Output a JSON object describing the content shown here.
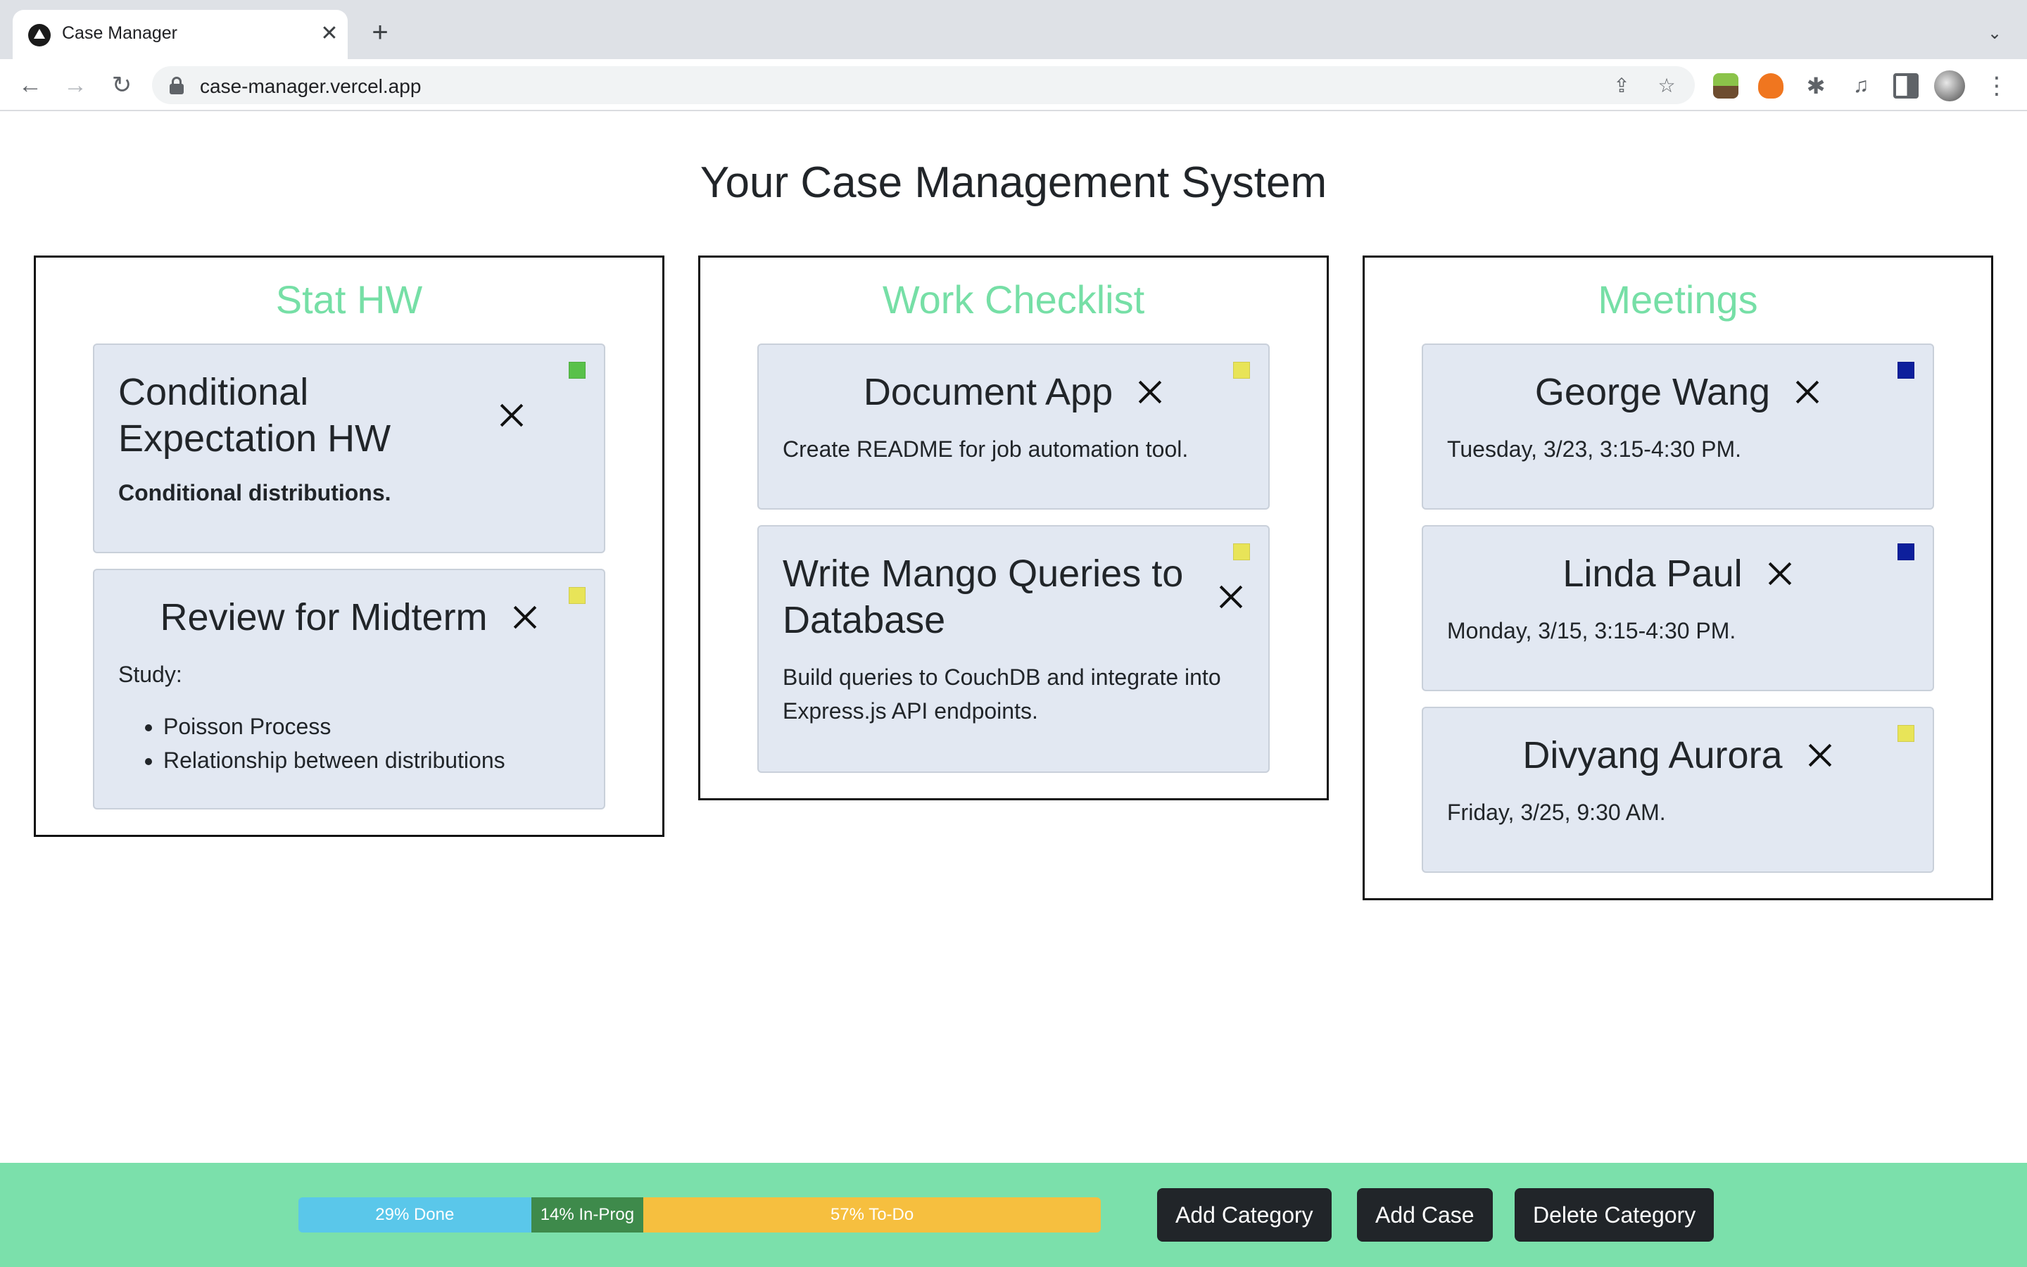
{
  "browser": {
    "tab_title": "Case Manager",
    "url": "case-manager.vercel.app"
  },
  "page": {
    "title": "Your Case Management System"
  },
  "categories": [
    {
      "title": "Stat HW",
      "cases": [
        {
          "title": "Conditional Expectation HW",
          "description": "Conditional distributions.",
          "status_color": "#59c14a"
        },
        {
          "title": "Review for Midterm",
          "description": "Study:",
          "items": [
            "Poisson Process",
            "Relationship between distributions"
          ],
          "status_color": "#e8e458"
        }
      ]
    },
    {
      "title": "Work Checklist",
      "cases": [
        {
          "title": "Document App",
          "description": "Create README for job automation tool.",
          "status_color": "#e8e458"
        },
        {
          "title": "Write Mango Queries to Database",
          "description": "Build queries to CouchDB and integrate into Express.js API endpoints.",
          "status_color": "#e8e458"
        }
      ]
    },
    {
      "title": "Meetings",
      "cases": [
        {
          "title": "George Wang",
          "description": "Tuesday, 3/23, 3:15-4:30 PM.",
          "status_color": "#0d1f9c"
        },
        {
          "title": "Linda Paul",
          "description": "Monday, 3/15, 3:15-4:30 PM.",
          "status_color": "#0d1f9c"
        },
        {
          "title": "Divyang Aurora",
          "description": "Friday, 3/25, 9:30 AM.",
          "status_color": "#e8e458"
        }
      ]
    }
  ],
  "footer": {
    "progress": [
      {
        "label": "29% Done",
        "percent": 29,
        "color": "#5ac7ea"
      },
      {
        "label": "14% In-Prog",
        "percent": 14,
        "color": "#3e8a4b"
      },
      {
        "label": "57% To-Do",
        "percent": 57,
        "color": "#f6bf3f"
      }
    ],
    "buttons": {
      "add_category": "Add Category",
      "add_case": "Add Case",
      "delete_category": "Delete Category"
    }
  },
  "colors": {
    "category_title": "#76dfa6",
    "footer_bg": "#7be0ab",
    "card_bg": "#e2e8f2"
  }
}
